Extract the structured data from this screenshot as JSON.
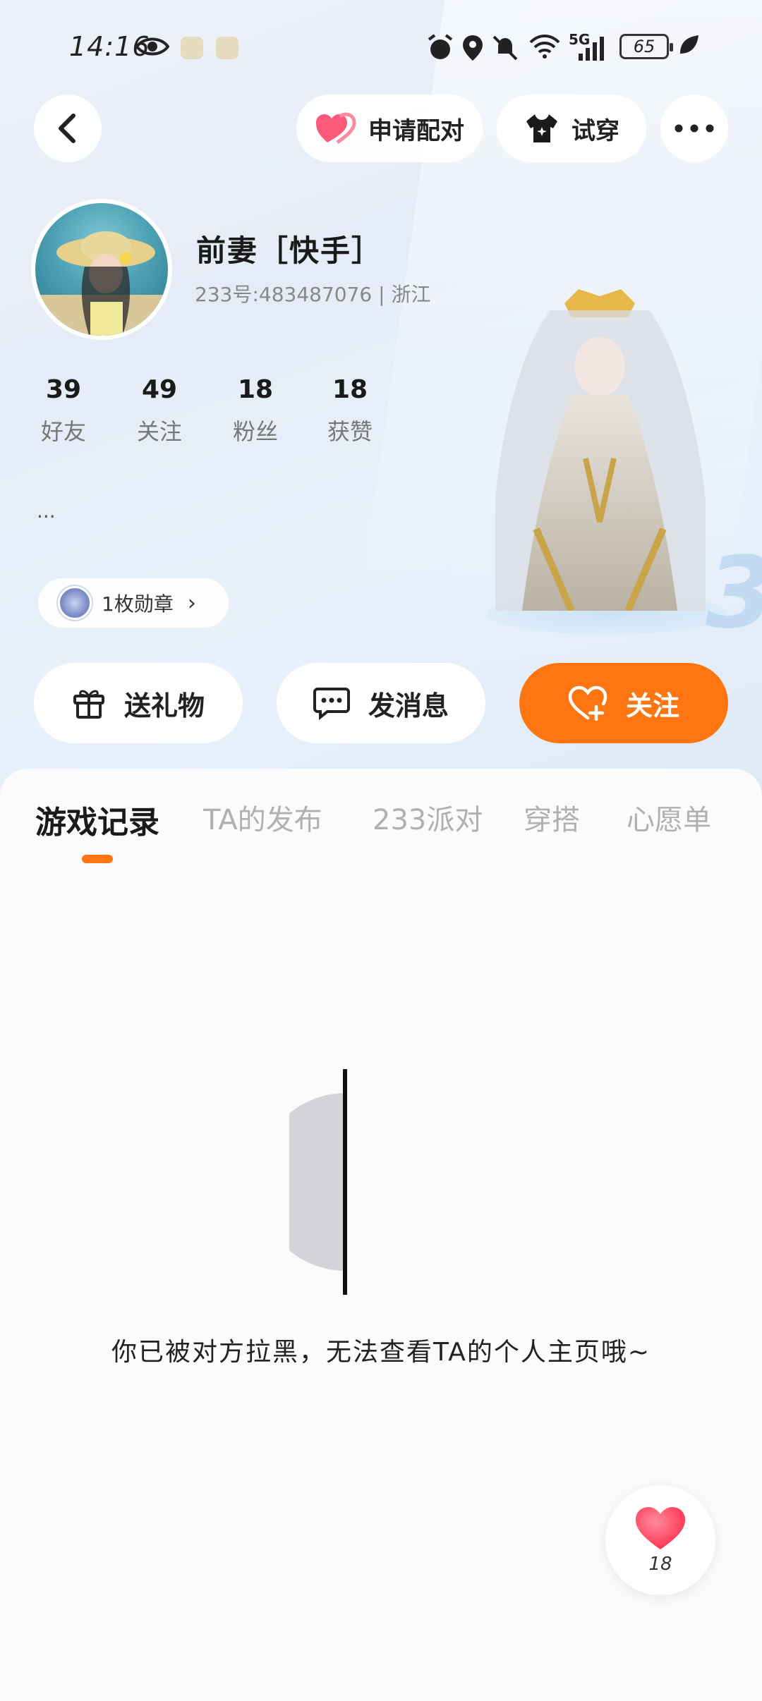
{
  "status_bar": {
    "time": "14:16",
    "network": "5G",
    "battery": "65"
  },
  "top_nav": {
    "pair_label": "申请配对",
    "try_on_label": "试穿"
  },
  "profile": {
    "nickname": "前妻［快手］",
    "id_line": "233号:483487076 | 浙江",
    "bio": "...",
    "stats": [
      {
        "value": "39",
        "label": "好友"
      },
      {
        "value": "49",
        "label": "关注"
      },
      {
        "value": "18",
        "label": "粉丝"
      },
      {
        "value": "18",
        "label": "获赞"
      }
    ],
    "medal_label": "1枚勋章"
  },
  "actions": {
    "gift": "送礼物",
    "message": "发消息",
    "follow": "关注"
  },
  "tabs": [
    {
      "label": "游戏记录",
      "active": true
    },
    {
      "label": "TA的发布",
      "active": false
    },
    {
      "label": "233派对",
      "active": false
    },
    {
      "label": "穿搭",
      "active": false
    },
    {
      "label": "心愿单",
      "active": false
    }
  ],
  "blocked_message": "你已被对方拉黑，无法查看TA的个人主页哦~",
  "like_count": "18",
  "colors": {
    "accent": "#ff7511",
    "heart": "#ff4d6a"
  }
}
